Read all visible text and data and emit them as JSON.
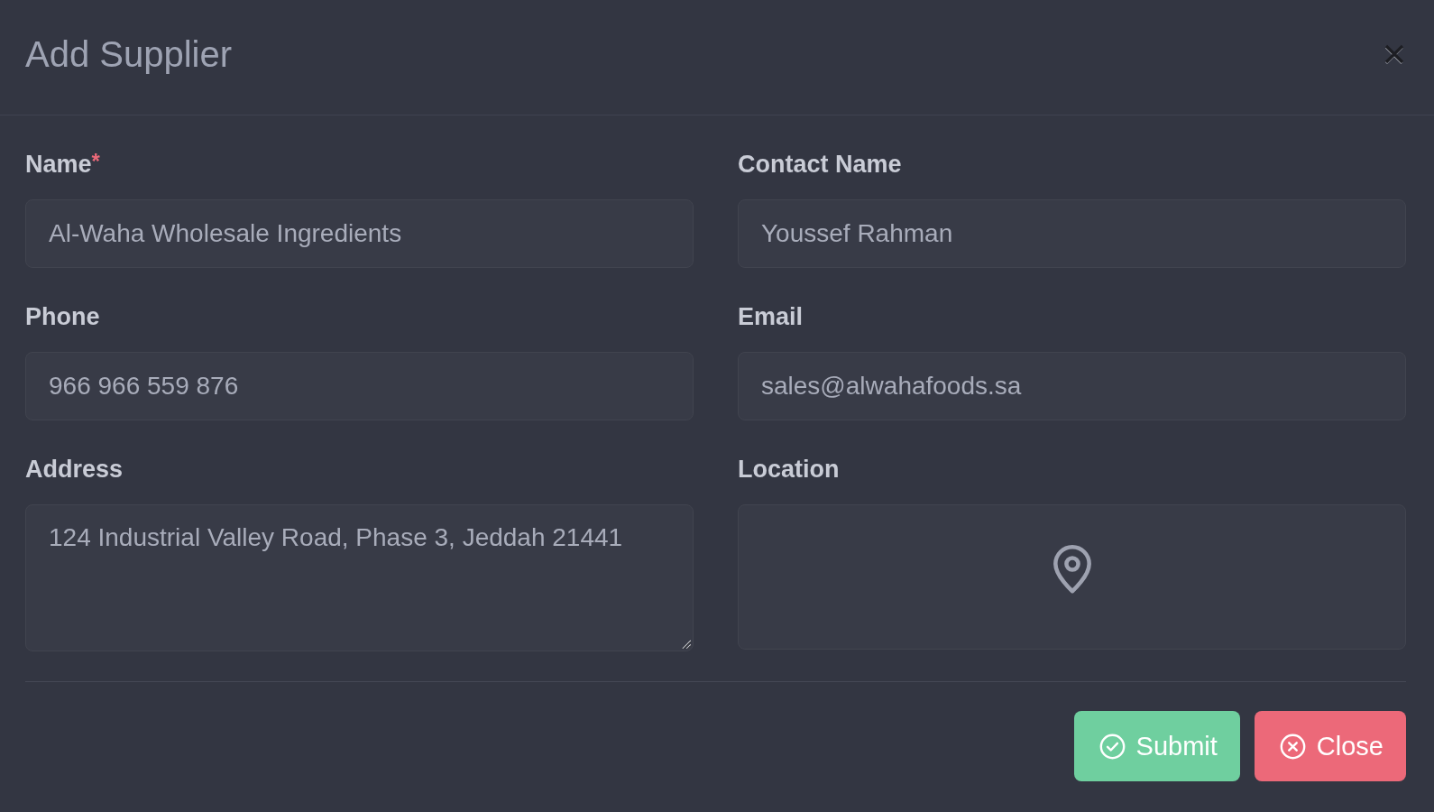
{
  "dialog": {
    "title": "Add Supplier"
  },
  "fields": [
    {
      "kind": "text",
      "label": "Name",
      "required_mark": "*",
      "value": "Al-Waha Wholesale Ingredients"
    },
    {
      "kind": "text",
      "label": "Contact Name",
      "value": "Youssef Rahman"
    },
    {
      "kind": "text",
      "label": "Phone",
      "value": "966 966 559 876"
    },
    {
      "kind": "text",
      "label": "Email",
      "value": "sales@alwahafoods.sa"
    },
    {
      "kind": "textarea",
      "label": "Address",
      "value": "124 Industrial Valley Road, Phase 3, Jeddah 21441"
    },
    {
      "kind": "map",
      "label": "Location"
    }
  ],
  "buttons": [
    {
      "kind": "submit",
      "label": "Submit"
    },
    {
      "kind": "close",
      "label": "Close"
    }
  ]
}
